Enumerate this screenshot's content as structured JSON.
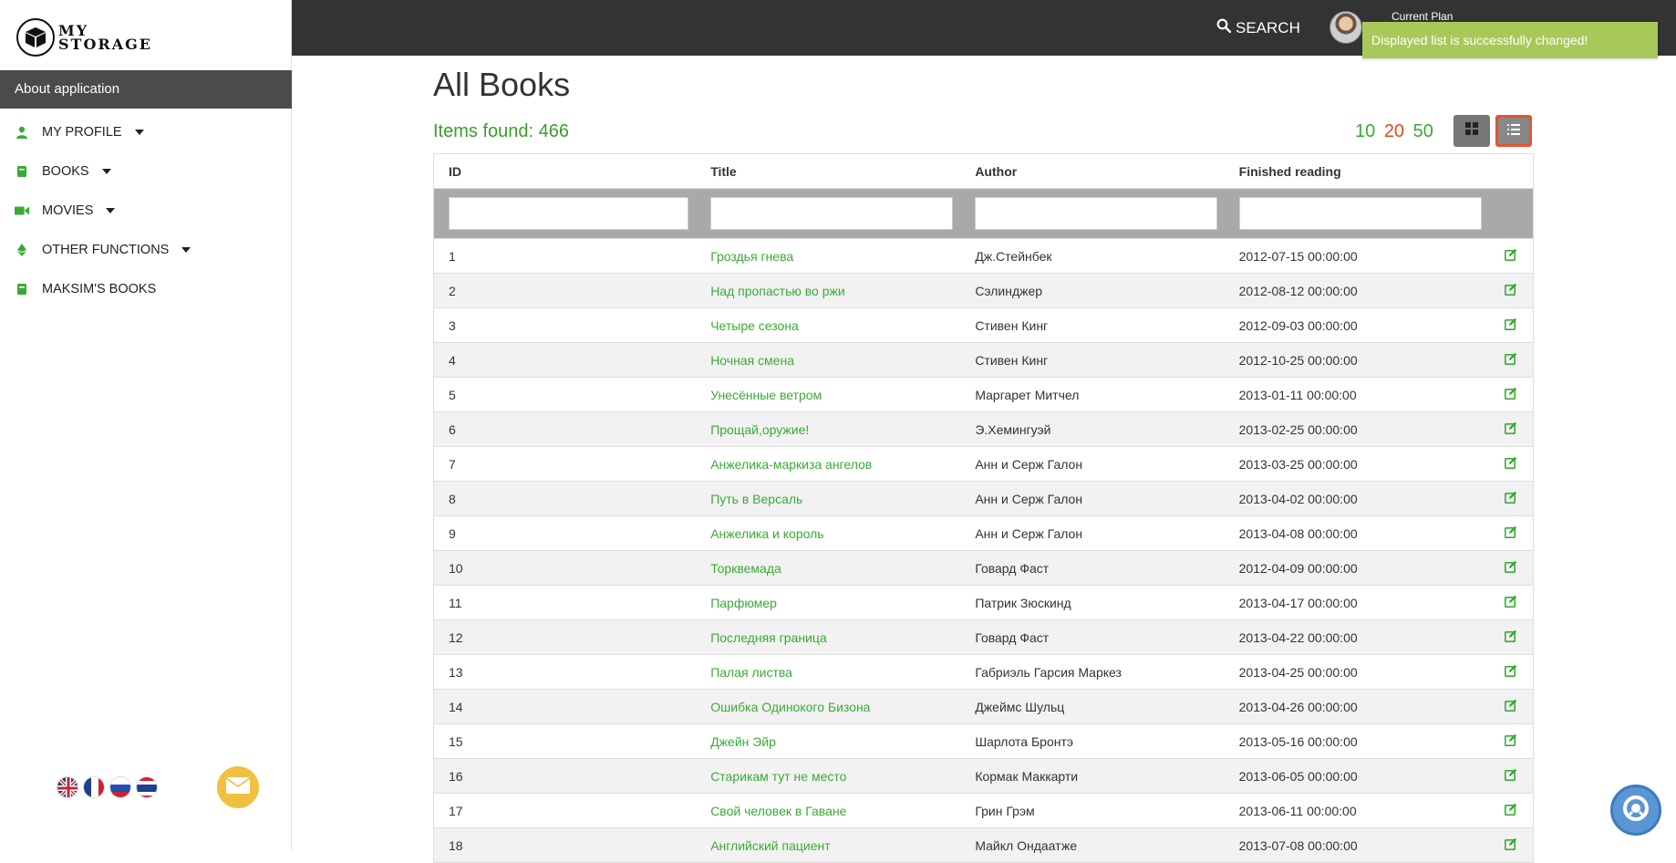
{
  "app": {
    "logo_line1": "MY",
    "logo_line2": "STORAGE"
  },
  "sidebar": {
    "about_label": "About application",
    "items": [
      {
        "label": "MY PROFILE",
        "icon": "user-icon",
        "has_caret": true
      },
      {
        "label": "BOOKS",
        "icon": "book-icon",
        "has_caret": true
      },
      {
        "label": "MOVIES",
        "icon": "video-camera-icon",
        "has_caret": true
      },
      {
        "label": "OTHER FUNCTIONS",
        "icon": "ethereum-icon",
        "has_caret": true
      },
      {
        "label": "MAKSIM'S BOOKS",
        "icon": "book-icon",
        "has_caret": false
      }
    ],
    "languages": [
      "English",
      "Français",
      "Русский",
      "ไทย"
    ]
  },
  "topbar": {
    "search_label": "SEARCH",
    "plan_label": "Current Plan"
  },
  "toast": {
    "message": "Displayed list is successfully changed!"
  },
  "main": {
    "title": "All Books",
    "items_found": "Items found: 466",
    "per_page": [
      {
        "value": "10",
        "active": false
      },
      {
        "value": "20",
        "active": true
      },
      {
        "value": "50",
        "active": false
      }
    ],
    "view_mode": "list"
  },
  "table": {
    "columns": [
      "ID",
      "Title",
      "Author",
      "Finished reading"
    ],
    "rows": [
      {
        "id": "1",
        "title": "Гроздья гнева",
        "author": "Дж.Стейнбек",
        "date": "2012-07-15 00:00:00"
      },
      {
        "id": "2",
        "title": "Над пропастью во ржи",
        "author": "Сэлинджер",
        "date": "2012-08-12 00:00:00"
      },
      {
        "id": "3",
        "title": "Четыре сезона",
        "author": "Стивен Кинг",
        "date": "2012-09-03 00:00:00"
      },
      {
        "id": "4",
        "title": "Ночная смена",
        "author": "Стивен Кинг",
        "date": "2012-10-25 00:00:00"
      },
      {
        "id": "5",
        "title": "Унесённые ветром",
        "author": "Маргарет Митчел",
        "date": "2013-01-11 00:00:00"
      },
      {
        "id": "6",
        "title": "Прощай,оружие!",
        "author": "Э.Хемингуэй",
        "date": "2013-02-25 00:00:00"
      },
      {
        "id": "7",
        "title": "Анжелика-маркиза ангелов",
        "author": "Анн и Серж Галон",
        "date": "2013-03-25 00:00:00"
      },
      {
        "id": "8",
        "title": "Путь в Версаль",
        "author": "Анн и Серж Галон",
        "date": "2013-04-02 00:00:00"
      },
      {
        "id": "9",
        "title": "Анжелика и король",
        "author": "Анн и Серж Галон",
        "date": "2013-04-08 00:00:00"
      },
      {
        "id": "10",
        "title": "Торквемада",
        "author": "Говард Фаст",
        "date": "2012-04-09 00:00:00"
      },
      {
        "id": "11",
        "title": "Парфюмер",
        "author": "Патрик Зюскинд",
        "date": "2013-04-17 00:00:00"
      },
      {
        "id": "12",
        "title": "Последняя граница",
        "author": "Говард Фаст",
        "date": "2013-04-22 00:00:00"
      },
      {
        "id": "13",
        "title": "Палая листва",
        "author": "Габриэль Гарсия Маркез",
        "date": "2013-04-25 00:00:00"
      },
      {
        "id": "14",
        "title": "Ошибка Одинокого Бизона",
        "author": "Джеймс Шульц",
        "date": "2013-04-26 00:00:00"
      },
      {
        "id": "15",
        "title": "Джейн Эйр",
        "author": "Шарлота Бронтэ",
        "date": "2013-05-16 00:00:00"
      },
      {
        "id": "16",
        "title": "Старикам тут не место",
        "author": "Кормак Маккарти",
        "date": "2013-06-05 00:00:00"
      },
      {
        "id": "17",
        "title": "Свой человек в Гаване",
        "author": "Грин Грэм",
        "date": "2013-06-11 00:00:00"
      },
      {
        "id": "18",
        "title": "Английский пациент",
        "author": "Майкл Ондаатже",
        "date": "2013-07-08 00:00:00"
      }
    ]
  },
  "colors": {
    "accent_green": "#3aaa35",
    "topbar": "#333333",
    "toast": "#a8c95a",
    "per_page_active": "#e04a1f",
    "highlight_border": "#e8532f"
  }
}
